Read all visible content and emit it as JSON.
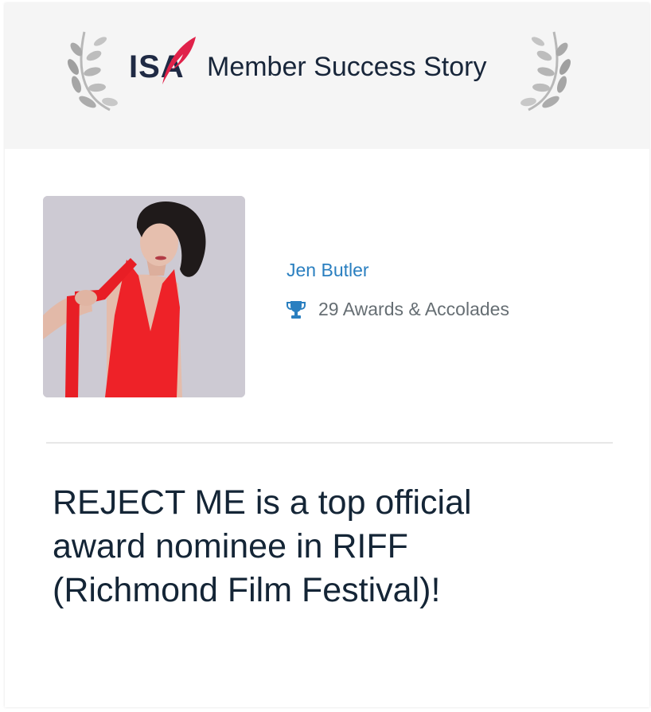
{
  "header": {
    "logo_text": "IS",
    "logo_suffix": "A",
    "title": "Member Success Story"
  },
  "member": {
    "name": "Jen Butler",
    "awards_icon": "trophy-icon",
    "awards": "29 Awards & Accolades"
  },
  "story": {
    "headline": "REJECT ME is a top official award nominee in RIFF (Richmond Film Festival)!"
  },
  "colors": {
    "header_bg": "#f5f5f5",
    "link": "#2a7fc0",
    "brand_red": "#e0224a",
    "brand_navy": "#1f2a44",
    "muted_text": "#666e73"
  }
}
